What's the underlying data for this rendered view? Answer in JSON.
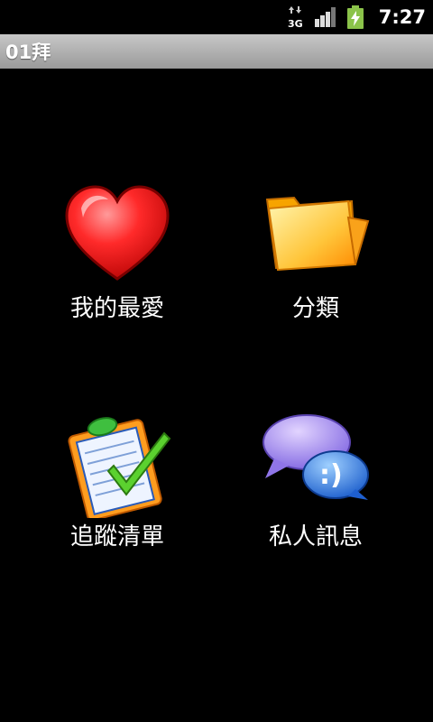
{
  "status_bar": {
    "network": "3G",
    "time": "7:27",
    "icons": [
      "data-transfer-icon",
      "signal-strength-icon",
      "battery-charging-icon"
    ]
  },
  "title_bar": {
    "title": "01拜"
  },
  "menu": {
    "items": [
      {
        "label": "我的最愛",
        "icon": "heart-icon"
      },
      {
        "label": "分類",
        "icon": "folder-icon"
      },
      {
        "label": "追蹤清單",
        "icon": "clipboard-check-icon"
      },
      {
        "label": "私人訊息",
        "icon": "chat-bubbles-icon"
      }
    ]
  },
  "colors": {
    "background": "#000000",
    "title_bar": "#b0b0b0",
    "text": "#ffffff",
    "battery": "#8bc34a"
  }
}
